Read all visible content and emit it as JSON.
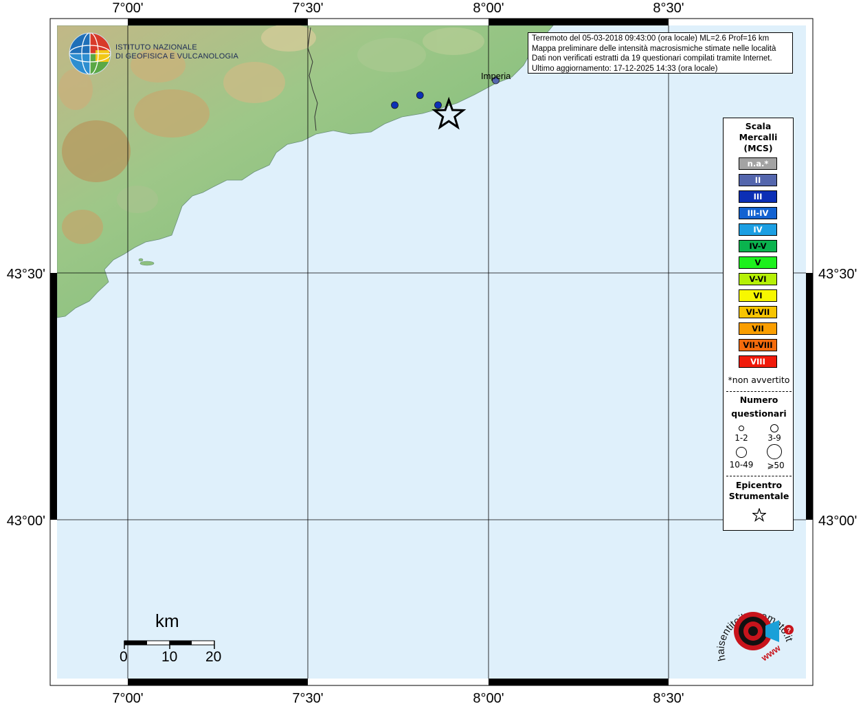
{
  "map": {
    "lon_ticks": [
      "7°00'",
      "7°30'",
      "8°00'",
      "8°30'"
    ],
    "lat_ticks": [
      "43°30'",
      "43°00'"
    ],
    "city_label": "Imperia"
  },
  "header": {
    "institute_line1": "ISTITUTO NAZIONALE",
    "institute_line2": "DI GEOFISICA E VULCANOLOGIA"
  },
  "info": {
    "line1": "Terremoto del 05-03-2018 09:43:00 (ora locale) ML=2.6 Prof=16 km",
    "line2": "Mappa preliminare delle intensità macrosismiche stimate nelle località",
    "line3": "Dati non verificati estratti da 19 questionari compilati tramite Internet.",
    "line4": "Ultimo aggiornamento: 17-12-2025 14:33 (ora locale)"
  },
  "legend": {
    "title_line1": "Scala",
    "title_line2": "Mercalli",
    "title_line3": "(MCS)",
    "levels": [
      {
        "label": "n.a.*",
        "color": "#a3a3a3",
        "text_color": "#ffffff"
      },
      {
        "label": "II",
        "color": "#5466ad",
        "text_color": "#ffffff"
      },
      {
        "label": "III",
        "color": "#0c2fb5",
        "text_color": "#ffffff"
      },
      {
        "label": "III-IV",
        "color": "#1262d1",
        "text_color": "#ffffff"
      },
      {
        "label": "IV",
        "color": "#1c9fe3",
        "text_color": "#ffffff"
      },
      {
        "label": "IV-V",
        "color": "#0ab34e",
        "text_color": "#000000"
      },
      {
        "label": "V",
        "color": "#1df01d",
        "text_color": "#000000"
      },
      {
        "label": "V-VI",
        "color": "#b5f007",
        "text_color": "#000000"
      },
      {
        "label": "VI",
        "color": "#f7f700",
        "text_color": "#000000"
      },
      {
        "label": "VI-VII",
        "color": "#f7c400",
        "text_color": "#000000"
      },
      {
        "label": "VII",
        "color": "#fa9e00",
        "text_color": "#000000"
      },
      {
        "label": "VII-VIII",
        "color": "#f56b0c",
        "text_color": "#000000"
      },
      {
        "label": "VIII",
        "color": "#f01a0a",
        "text_color": "#ffffff"
      }
    ],
    "not_felt_note": "*non avvertito",
    "count_title_line1": "Numero",
    "count_title_line2": "questionari",
    "count_labels": [
      "1-2",
      "3-9",
      "10-49",
      "⩾50"
    ],
    "epicenter_title_line1": "Epicentro",
    "epicenter_title_line2": "Strumentale"
  },
  "scalebar": {
    "unit": "km",
    "labels": [
      "0",
      "10",
      "20"
    ]
  },
  "observations": [
    {
      "lon": 7.74,
      "lat": 43.84,
      "intensity": "III",
      "questionnaires": "3-9"
    },
    {
      "lon": 7.86,
      "lat": 43.84,
      "intensity": "III",
      "questionnaires": "3-9"
    },
    {
      "lon": 7.81,
      "lat": 43.86,
      "intensity": "III",
      "questionnaires": "3-9"
    },
    {
      "lon": 8.02,
      "lat": 43.89,
      "intensity": "II",
      "questionnaires": "3-9"
    }
  ],
  "epicenter": {
    "lon": 7.89,
    "lat": 43.82
  },
  "colors": {
    "sea": "#dff0fb",
    "land_low": "#8dc07e",
    "land_mid": "#c8c896",
    "land_high": "#b59a66",
    "observation_marker": "#0c2fb5"
  },
  "logo": {
    "text": "haisentitoilterremoto.it",
    "url_text": "www"
  }
}
